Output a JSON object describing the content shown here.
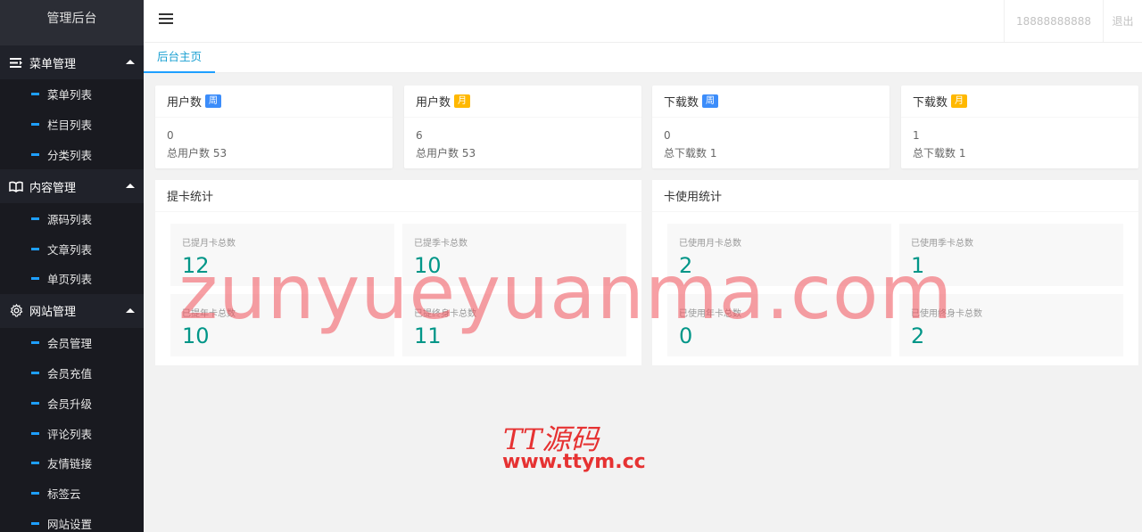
{
  "sidebar": {
    "logo": "管理后台",
    "groups": [
      {
        "title": "菜单管理",
        "icon": "list-icon",
        "items": [
          "菜单列表",
          "栏目列表",
          "分类列表"
        ]
      },
      {
        "title": "内容管理",
        "icon": "book-icon",
        "items": [
          "源码列表",
          "文章列表",
          "单页列表"
        ]
      },
      {
        "title": "网站管理",
        "icon": "gear-icon",
        "items": [
          "会员管理",
          "会员充值",
          "会员升级",
          "评论列表",
          "友情链接",
          "标签云",
          "网站设置"
        ]
      }
    ]
  },
  "topbar": {
    "user": "18888888888",
    "logout": "退出"
  },
  "tabs": {
    "active": "后台主页"
  },
  "stats": [
    {
      "title": "用户数",
      "badge": "周",
      "value": "0",
      "total": "总用户数 53"
    },
    {
      "title": "用户数",
      "badge": "月",
      "value": "6",
      "total": "总用户数 53"
    },
    {
      "title": "下载数",
      "badge": "周",
      "value": "0",
      "total": "总下载数 1"
    },
    {
      "title": "下载数",
      "badge": "月",
      "value": "1",
      "total": "总下载数 1"
    }
  ],
  "panels": [
    {
      "title": "提卡统计",
      "tiles": [
        {
          "label": "已提月卡总数",
          "value": "12"
        },
        {
          "label": "已提季卡总数",
          "value": "10"
        },
        {
          "label": "已提年卡总数",
          "value": "10"
        },
        {
          "label": "已提终身卡总数",
          "value": "11"
        }
      ]
    },
    {
      "title": "卡使用统计",
      "tiles": [
        {
          "label": "已使用月卡总数",
          "value": "2"
        },
        {
          "label": "已使用季卡总数",
          "value": "1"
        },
        {
          "label": "已使用年卡总数",
          "value": "0"
        },
        {
          "label": "已使用终身卡总数",
          "value": "2"
        }
      ]
    }
  ],
  "watermarks": {
    "main": "zunyueyuanma.com",
    "brand": "TT源码",
    "site": "www.ttym.cc"
  },
  "colors": {
    "sidebar_bg": "#20222a",
    "accent": "#1e9fff",
    "value_color": "#009688",
    "badge_week": "#3c8dfa",
    "badge_month": "#ffb800"
  }
}
